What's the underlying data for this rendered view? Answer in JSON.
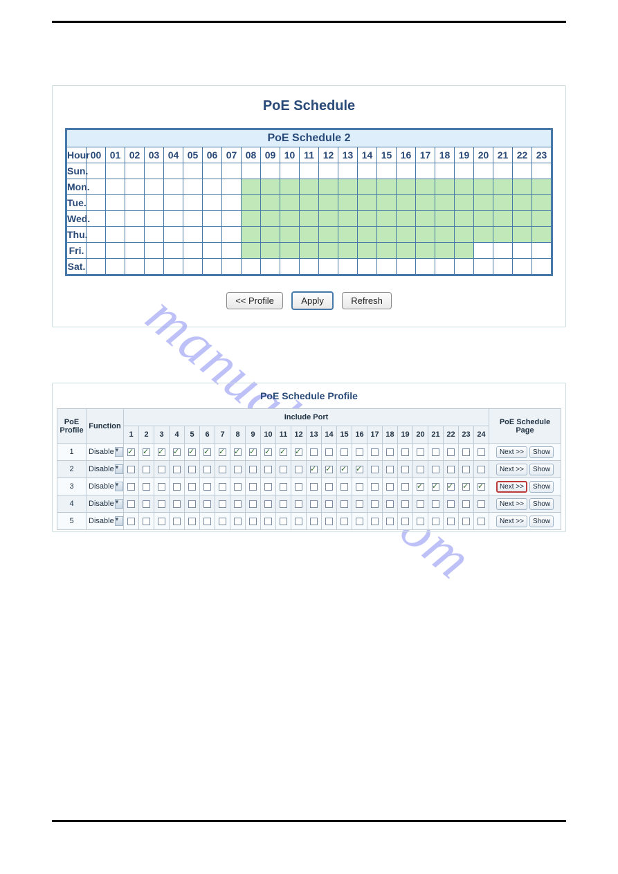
{
  "watermark": "manualslive.com",
  "schedule": {
    "title": "PoE Schedule",
    "group_title": "PoE Schedule 2",
    "hour_label": "Hour",
    "hours": [
      "00",
      "01",
      "02",
      "03",
      "04",
      "05",
      "06",
      "07",
      "08",
      "09",
      "10",
      "11",
      "12",
      "13",
      "14",
      "15",
      "16",
      "17",
      "18",
      "19",
      "20",
      "21",
      "22",
      "23"
    ],
    "days": [
      "Sun.",
      "Mon.",
      "Tue.",
      "Wed.",
      "Thu.",
      "Fri.",
      "Sat."
    ],
    "on_cells": {
      "Sun.": [],
      "Mon.": [
        8,
        9,
        10,
        11,
        12,
        13,
        14,
        15,
        16,
        17,
        18,
        19,
        20,
        21,
        22,
        23
      ],
      "Tue.": [
        8,
        9,
        10,
        11,
        12,
        13,
        14,
        15,
        16,
        17,
        18,
        19,
        20,
        21,
        22,
        23
      ],
      "Wed.": [
        8,
        9,
        10,
        11,
        12,
        13,
        14,
        15,
        16,
        17,
        18,
        19,
        20,
        21,
        22,
        23
      ],
      "Thu.": [
        8,
        9,
        10,
        11,
        12,
        13,
        14,
        15,
        16,
        17,
        18,
        19,
        20,
        21,
        22,
        23
      ],
      "Fri.": [
        8,
        9,
        10,
        11,
        12,
        13,
        14,
        15,
        16,
        17,
        18,
        19
      ],
      "Sat.": []
    },
    "buttons": {
      "profile": "<< Profile",
      "apply": "Apply",
      "refresh": "Refresh"
    }
  },
  "profile": {
    "title": "PoE Schedule Profile",
    "col_profile": "PoE Profile",
    "col_function": "Function",
    "col_include": "Include Port",
    "col_page": "PoE Schedule Page",
    "ports": [
      "1",
      "2",
      "3",
      "4",
      "5",
      "6",
      "7",
      "8",
      "9",
      "10",
      "11",
      "12",
      "13",
      "14",
      "15",
      "16",
      "17",
      "18",
      "19",
      "20",
      "21",
      "22",
      "23",
      "24"
    ],
    "rows": [
      {
        "id": "1",
        "func": "Disable",
        "checked": [
          1,
          2,
          3,
          4,
          5,
          6,
          7,
          8,
          9,
          10,
          11,
          12
        ],
        "next": "Next >>",
        "show": "Show",
        "hl": false
      },
      {
        "id": "2",
        "func": "Disable",
        "checked": [
          13,
          14,
          15,
          16
        ],
        "next": "Next >>",
        "show": "Show",
        "hl": false
      },
      {
        "id": "3",
        "func": "Disable",
        "checked": [
          20,
          21,
          22,
          23,
          24
        ],
        "next": "Next >>",
        "show": "Show",
        "hl": true
      },
      {
        "id": "4",
        "func": "Disable",
        "checked": [],
        "next": "Next >>",
        "show": "Show",
        "hl": false
      },
      {
        "id": "5",
        "func": "Disable",
        "checked": [],
        "next": "Next >>",
        "show": "Show",
        "hl": false
      }
    ]
  }
}
